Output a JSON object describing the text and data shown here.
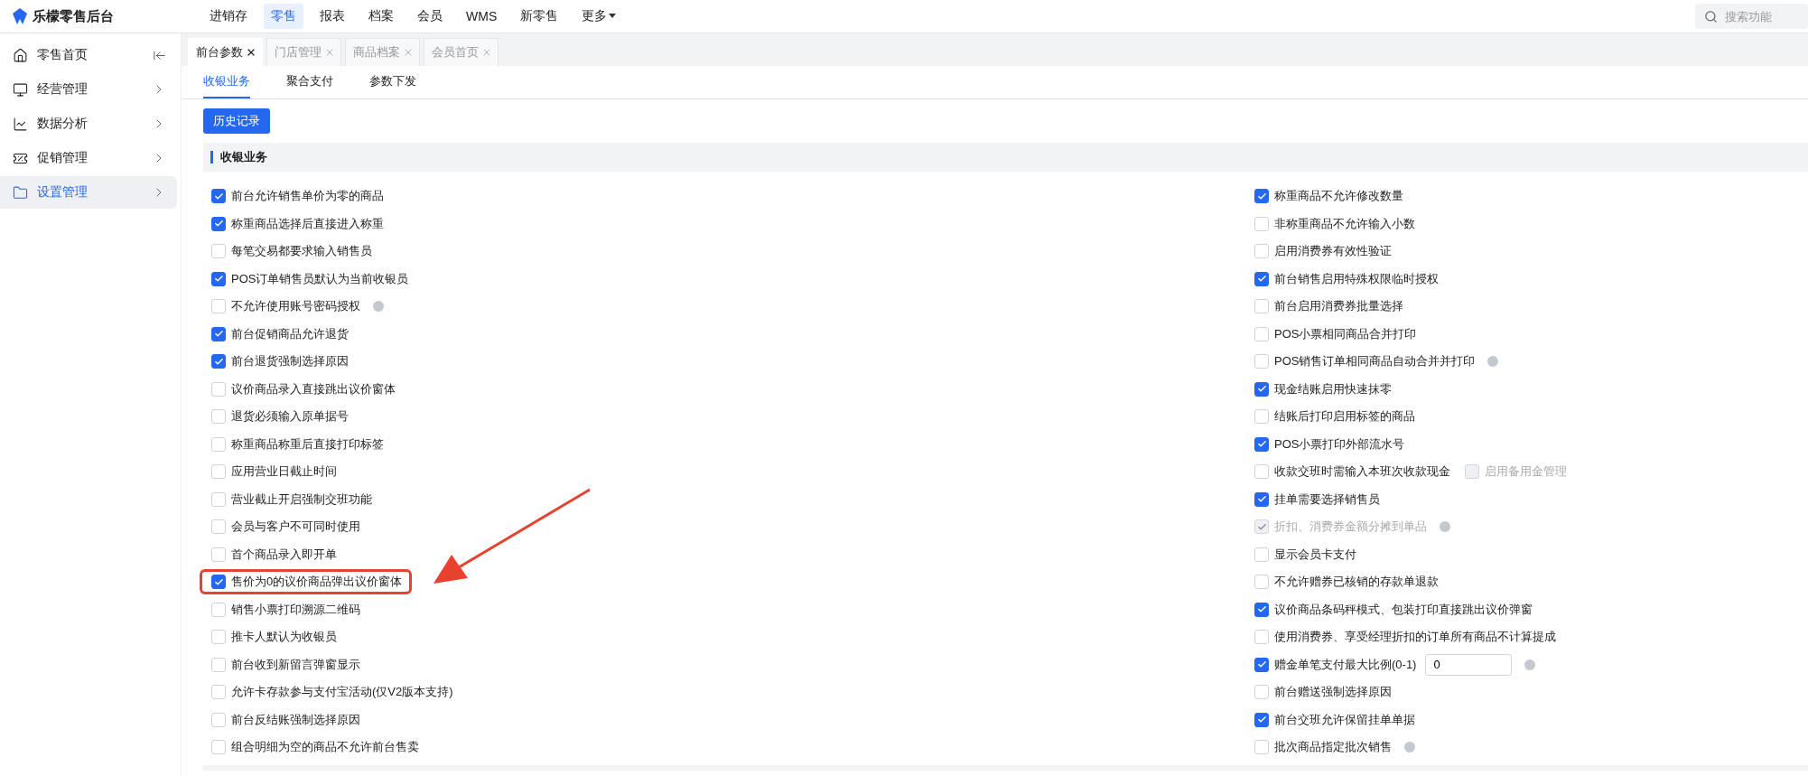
{
  "app": {
    "title": "乐檬零售后台"
  },
  "nav": [
    {
      "label": "进销存",
      "selected": false
    },
    {
      "label": "零售",
      "selected": true
    },
    {
      "label": "报表",
      "selected": false
    },
    {
      "label": "档案",
      "selected": false
    },
    {
      "label": "会员",
      "selected": false
    },
    {
      "label": "WMS",
      "selected": false
    },
    {
      "label": "新零售",
      "selected": false
    },
    {
      "label": "更多",
      "selected": false,
      "dropdown": true
    }
  ],
  "search": {
    "placeholder": "搜索功能"
  },
  "sidebar": {
    "items": [
      {
        "label": "零售首页",
        "kind": "home",
        "selected": false
      },
      {
        "label": "经营管理",
        "kind": "monitor",
        "selected": false
      },
      {
        "label": "数据分析",
        "kind": "chart",
        "selected": false
      },
      {
        "label": "促销管理",
        "kind": "promo",
        "selected": false
      },
      {
        "label": "设置管理",
        "kind": "folder",
        "selected": true
      }
    ]
  },
  "tabs": [
    {
      "label": "前台参数",
      "selected": true
    },
    {
      "label": "门店管理",
      "selected": false
    },
    {
      "label": "商品档案",
      "selected": false
    },
    {
      "label": "会员首页",
      "selected": false
    }
  ],
  "subtabs": [
    {
      "label": "收银业务",
      "selected": true
    },
    {
      "label": "聚合支付",
      "selected": false
    },
    {
      "label": "参数下发",
      "selected": false
    }
  ],
  "history_button": "历史记录",
  "section": {
    "title": "收银业务"
  },
  "left_options": [
    {
      "label": "前台允许销售单价为零的商品",
      "checked": true,
      "help": false,
      "highlighted": false
    },
    {
      "label": "称重商品选择后直接进入称重",
      "checked": true,
      "help": false,
      "highlighted": false
    },
    {
      "label": "每笔交易都要求输入销售员",
      "checked": false,
      "help": false,
      "highlighted": false
    },
    {
      "label": "POS订单销售员默认为当前收银员",
      "checked": true,
      "help": false,
      "highlighted": false
    },
    {
      "label": "不允许使用账号密码授权",
      "checked": false,
      "help": true,
      "highlighted": false
    },
    {
      "label": "前台促销商品允许退货",
      "checked": true,
      "help": false,
      "highlighted": false
    },
    {
      "label": "前台退货强制选择原因",
      "checked": true,
      "help": false,
      "highlighted": false
    },
    {
      "label": "议价商品录入直接跳出议价窗体",
      "checked": false,
      "help": false,
      "highlighted": false
    },
    {
      "label": "退货必须输入原单据号",
      "checked": false,
      "help": false,
      "highlighted": false
    },
    {
      "label": "称重商品称重后直接打印标签",
      "checked": false,
      "help": false,
      "highlighted": false
    },
    {
      "label": "应用营业日截止时间",
      "checked": false,
      "help": false,
      "highlighted": false
    },
    {
      "label": "营业截止开启强制交班功能",
      "checked": false,
      "help": false,
      "highlighted": false
    },
    {
      "label": "会员与客户不可同时使用",
      "checked": false,
      "help": false,
      "highlighted": false
    },
    {
      "label": "首个商品录入即开单",
      "checked": false,
      "help": false,
      "highlighted": false
    },
    {
      "label": "售价为0的议价商品弹出议价窗体",
      "checked": true,
      "help": false,
      "highlighted": true
    },
    {
      "label": "销售小票打印溯源二维码",
      "checked": false,
      "help": false,
      "highlighted": false
    },
    {
      "label": "推卡人默认为收银员",
      "checked": false,
      "help": false,
      "highlighted": false
    },
    {
      "label": "前台收到新留言弹窗显示",
      "checked": false,
      "help": false,
      "highlighted": false
    },
    {
      "label": "允许卡存款参与支付宝活动(仅V2版本支持)",
      "checked": false,
      "help": false,
      "highlighted": false
    },
    {
      "label": "前台反结账强制选择原因",
      "checked": false,
      "help": false,
      "highlighted": false
    },
    {
      "label": "组合明细为空的商品不允许前台售卖",
      "checked": false,
      "help": false,
      "highlighted": false
    }
  ],
  "right_options": [
    {
      "label": "称重商品不允许修改数量",
      "checked": true,
      "disabled": false,
      "help": false
    },
    {
      "label": "非称重商品不允许输入小数",
      "checked": false,
      "disabled": false,
      "help": false
    },
    {
      "label": "启用消费券有效性验证",
      "checked": false,
      "disabled": false,
      "help": false
    },
    {
      "label": "前台销售启用特殊权限临时授权",
      "checked": true,
      "disabled": false,
      "help": false
    },
    {
      "label": "前台启用消费券批量选择",
      "checked": false,
      "disabled": false,
      "help": false
    },
    {
      "label": "POS小票相同商品合并打印",
      "checked": false,
      "disabled": false,
      "help": false
    },
    {
      "label": "POS销售订单相同商品自动合并并打印",
      "checked": false,
      "disabled": false,
      "help": true
    },
    {
      "label": "现金结账启用快速抹零",
      "checked": true,
      "disabled": false,
      "help": false
    },
    {
      "label": "结账后打印启用标签的商品",
      "checked": false,
      "disabled": false,
      "help": false
    },
    {
      "label": "POS小票打印外部流水号",
      "checked": true,
      "disabled": false,
      "help": false
    },
    {
      "label": "收款交班时需输入本班次收款现金",
      "checked": false,
      "disabled": false,
      "help": false,
      "extra": {
        "label": "启用备用金管理",
        "checked": false,
        "disabled": true
      }
    },
    {
      "label": "挂单需要选择销售员",
      "checked": true,
      "disabled": false,
      "help": false
    },
    {
      "label": "折扣、消费券金额分摊到单品",
      "checked": true,
      "disabled": true,
      "help": true
    },
    {
      "label": "显示会员卡支付",
      "checked": false,
      "disabled": false,
      "help": false
    },
    {
      "label": "不允许赠券已核销的存款单退款",
      "checked": false,
      "disabled": false,
      "help": false
    },
    {
      "label": "议价商品条码秤模式、包装打印直接跳出议价弹窗",
      "checked": true,
      "disabled": false,
      "help": false
    },
    {
      "label": "使用消费券、享受经理折扣的订单所有商品不计算提成",
      "checked": false,
      "disabled": false,
      "help": false
    },
    {
      "label": "赠金单笔支付最大比例(0-1)",
      "checked": true,
      "disabled": false,
      "help": true,
      "input_value": "0"
    },
    {
      "label": "前台赠送强制选择原因",
      "checked": false,
      "disabled": false,
      "help": false
    },
    {
      "label": "前台交班允许保留挂单单据",
      "checked": true,
      "disabled": false,
      "help": false
    },
    {
      "label": "批次商品指定批次销售",
      "checked": false,
      "disabled": false,
      "help": true
    }
  ]
}
